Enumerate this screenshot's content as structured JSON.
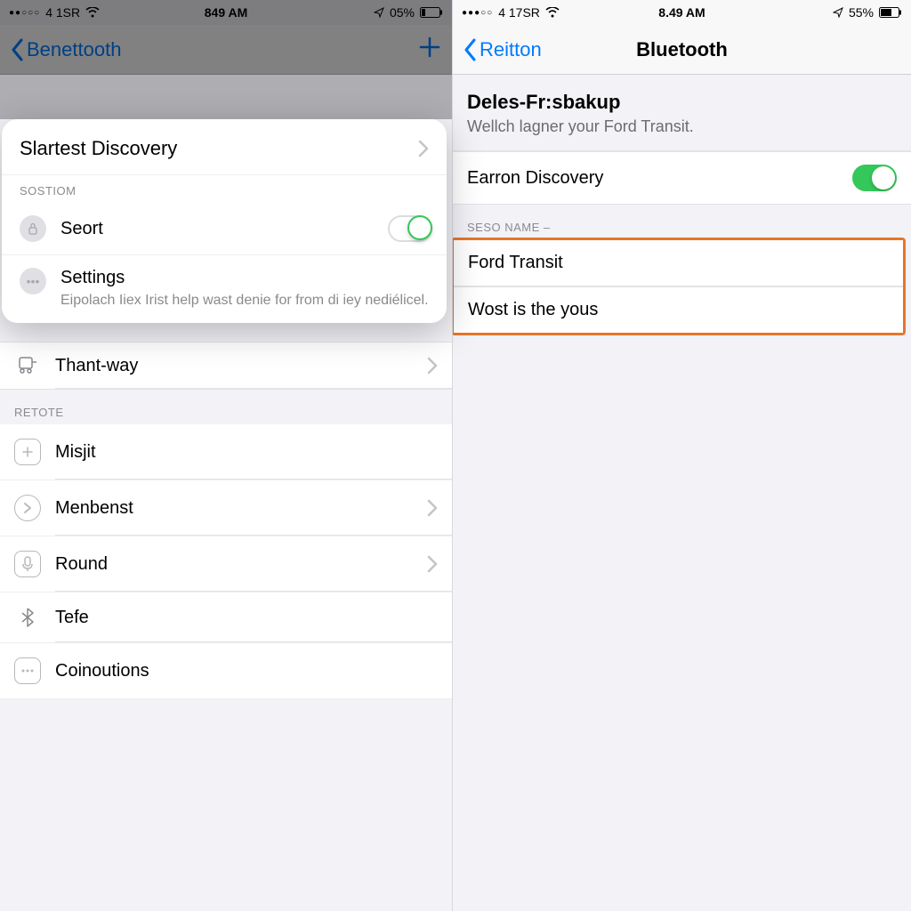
{
  "left": {
    "status": {
      "carrier": "4 1SR",
      "time": "849 AM",
      "battery": "05%"
    },
    "nav": {
      "back_label": "Benettooth"
    },
    "section_retote": "RETOTE",
    "items": [
      {
        "icon": "transit-icon",
        "label": "Thant-way"
      },
      {
        "icon": "plus-box-icon",
        "label": "Misjit"
      },
      {
        "icon": "chevron-circle-icon",
        "label": "Menbenst"
      },
      {
        "icon": "mic-icon",
        "label": "Round"
      },
      {
        "icon": "bluetooth-icon",
        "label": "Tefe"
      },
      {
        "icon": "dots-box-icon",
        "label": "Coinoutions"
      }
    ],
    "popup": {
      "title": "Slartest Discovery",
      "section": "SOSTIOM",
      "seort_label": "Seort",
      "settings_label": "Settings",
      "settings_sub": "Eipolach Iiex Irist help wast denie for from di iey nediélicel."
    }
  },
  "right": {
    "status": {
      "carrier": "4 17SR",
      "time": "8.49 AM",
      "battery": "55%"
    },
    "nav": {
      "back_label": "Reitton",
      "title": "Bluetooth"
    },
    "header": {
      "title": "Deles-Fr:sbakup",
      "sub": "Wellch lagner your Ford Transit."
    },
    "discovery_label": "Earron Discovery",
    "devices_section": "SESO NAME –",
    "devices": [
      {
        "label": "Ford Transit"
      },
      {
        "label": "Wost is the yous"
      }
    ]
  }
}
